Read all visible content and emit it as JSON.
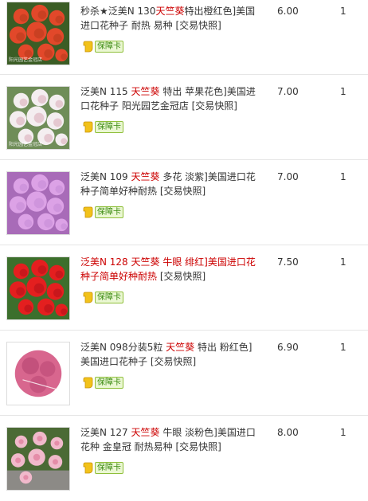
{
  "items": [
    {
      "title_parts": [
        {
          "t": "秒杀★泛美N 130",
          "hl": false
        },
        {
          "t": "天竺葵",
          "hl": true
        },
        {
          "t": "特出橙红色]美国进口花种子 耐热 易种 [交易快照]",
          "hl": false
        }
      ],
      "badge": "保障卡",
      "price": "6.00",
      "qty": "1",
      "thumb_watermark": "阳光园艺金冠店",
      "thumb_colors": [
        "#3b5d25",
        "#e2482a",
        "#b53a1c"
      ]
    },
    {
      "title_parts": [
        {
          "t": "泛美N 115 ",
          "hl": false
        },
        {
          "t": "天竺葵",
          "hl": true
        },
        {
          "t": " 特出 苹果花色]美国进口花种子 阳光园艺金冠店 [交易快照]",
          "hl": false
        }
      ],
      "badge": "保障卡",
      "price": "7.00",
      "qty": "1",
      "thumb_watermark": "阳光园艺金冠店",
      "thumb_colors": [
        "#6f8d58",
        "#f4eef0",
        "#d9a9b7"
      ]
    },
    {
      "title_parts": [
        {
          "t": "泛美N 109 ",
          "hl": false
        },
        {
          "t": "天竺葵",
          "hl": true
        },
        {
          "t": " 多花 淡紫]美国进口花种子简单好种耐热 [交易快照]",
          "hl": false
        }
      ],
      "badge": "保障卡",
      "price": "7.00",
      "qty": "1",
      "thumb_watermark": "",
      "thumb_colors": [
        "#a86bb8",
        "#dca2e6",
        "#c58ad6"
      ]
    },
    {
      "title_parts": [
        {
          "t": "泛美N 128 天竺葵 牛眼 绯红]美国进口花种子简单好种耐热",
          "hl": false
        },
        {
          "t": " [交易快照]",
          "hl": false
        }
      ],
      "title_red_first": true,
      "badge": "保障卡",
      "price": "7.50",
      "qty": "1",
      "thumb_watermark": "",
      "thumb_colors": [
        "#3c6f2c",
        "#e41f1f",
        "#b0101a"
      ]
    },
    {
      "title_parts": [
        {
          "t": "泛美N 098分装5粒 ",
          "hl": false
        },
        {
          "t": "天竺葵",
          "hl": true
        },
        {
          "t": " 特出 粉红色]美国进口花种子 [交易快照]",
          "hl": false
        }
      ],
      "badge": "保障卡",
      "price": "6.90",
      "qty": "1",
      "thumb_watermark": "",
      "thumb_colors": [
        "#ffffff",
        "#d8668e",
        "#b54270"
      ]
    },
    {
      "title_parts": [
        {
          "t": "泛美N 127 ",
          "hl": false
        },
        {
          "t": "天竺葵",
          "hl": true
        },
        {
          "t": " 牛眼 淡粉色]美国进口花种 金皇冠 耐热易种 [交易快照]",
          "hl": false
        }
      ],
      "badge": "保障卡",
      "price": "8.00",
      "qty": "1",
      "thumb_watermark": "",
      "thumb_colors": [
        "#4b6a35",
        "#f1b9cb",
        "#8c8a86"
      ]
    }
  ]
}
